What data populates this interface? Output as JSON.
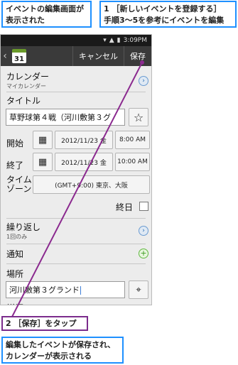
{
  "callouts": {
    "top_left": "イベントの編集画面が表示された",
    "top_right_1": "1 ［新しいイベントを登録する］",
    "top_right_2": "手順3～5を参考にイベントを編集",
    "step2": "2 ［保存］をタップ",
    "bottom": "編集したイベントが保存され、カレンダーが表示される"
  },
  "status_bar": {
    "time": "3:09PM"
  },
  "action_bar": {
    "calendar_day": "31",
    "cancel": "キャンセル",
    "save": "保存"
  },
  "form": {
    "calendar_label": "カレンダー",
    "calendar_value": "マイカレンダー",
    "title_label": "タイトル",
    "title_value": "草野球第４戦（河川敷第３グ",
    "start_label": "開始",
    "start_date": "2012/11/23 金",
    "start_time": "8:00 AM",
    "end_label": "終了",
    "end_date": "2012/11/23 金",
    "end_time": "10:00 AM",
    "timezone_label": "タイム\nゾーン",
    "timezone_value": "(GMT+9:00) 東京、大阪",
    "allday_label": "終日",
    "repeat_label": "繰り返し",
    "repeat_value": "1回のみ",
    "notify_label": "通知",
    "location_label": "場所",
    "location_value": "河川敷第３グランド",
    "details_label": "詳細"
  },
  "colors": {
    "callout_blue": "#1e90ff",
    "callout_purple": "#7b2c8c",
    "arrow": "#8b2a8f"
  }
}
